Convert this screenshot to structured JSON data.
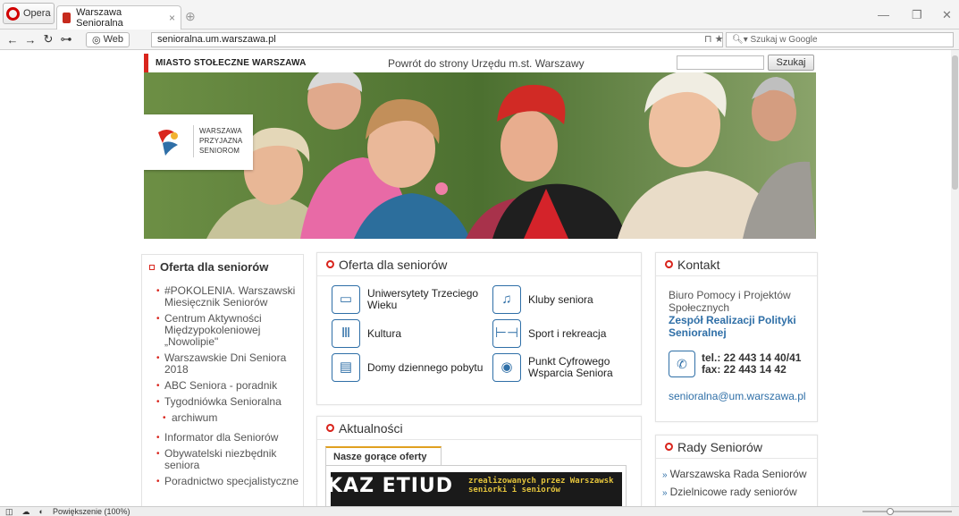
{
  "browser": {
    "menu_label": "Opera",
    "tab_title": "Warszawa Senioralna",
    "web_badge": "Web",
    "url": "senioralna.um.warszawa.pl",
    "search_placeholder": "Szukaj w Google",
    "status_zoom": "Powiększenie (100%)"
  },
  "header": {
    "city": "MIASTO STOŁECZNE WARSZAWA",
    "back_link": "Powrót do strony Urzędu m.st. Warszawy",
    "search_button": "Szukaj",
    "logo_lines": [
      "WARSZAWA",
      "PRZYJAZNA",
      "SENIOROM"
    ]
  },
  "left_menu": {
    "title": "Oferta dla seniorów",
    "items": [
      "#POKOLENIA. Warszawski Miesięcznik Seniorów",
      "Centrum Aktywności Międzypokoleniowej „Nowolipie\"",
      "Warszawskie Dni Seniora 2018",
      "ABC Seniora - poradnik",
      "Tygodniówka Senioralna",
      "archiwum",
      "Informator dla Seniorów",
      "Obywatelski niezbędnik seniora",
      "Poradnictwo specjalistyczne"
    ]
  },
  "offer_box": {
    "title": "Oferta dla seniorów",
    "items": [
      {
        "label": "Uniwersytety Trzeciego Wieku",
        "icon": "book-icon"
      },
      {
        "label": "Kluby seniora",
        "icon": "music-notes-icon"
      },
      {
        "label": "Kultura",
        "icon": "column-icon"
      },
      {
        "label": "Sport i rekreacja",
        "icon": "dumbbell-icon"
      },
      {
        "label": "Domy dziennego pobytu",
        "icon": "calendar-icon"
      },
      {
        "label": "Punkt Cyfrowego Wsparcia Seniora",
        "icon": "digital-support-icon"
      }
    ]
  },
  "contact_box": {
    "title": "Kontakt",
    "office": "Biuro Pomocy i Projektów Społecznych",
    "team": "Zespół Realizacji Polityki Senioralnej",
    "phone": "tel.: 22 443 14 40/41",
    "fax": "fax: 22 443 14 42",
    "email": "senioralna@um.warszawa.pl"
  },
  "news_box": {
    "title": "Aktualności",
    "tab": "Nasze gorące oferty",
    "banner_big": "KAZ ETIUD",
    "banner_small_1": "zrealizowanych przez Warszawsk",
    "banner_small_2": "seniorki i seniorów"
  },
  "councils_box": {
    "title": "Rady Seniorów",
    "items": [
      "Warszawska Rada Seniorów",
      "Dzielnicowe rady seniorów"
    ]
  },
  "colors": {
    "accent_red": "#d9251d",
    "link_blue": "#2f6fa7"
  }
}
